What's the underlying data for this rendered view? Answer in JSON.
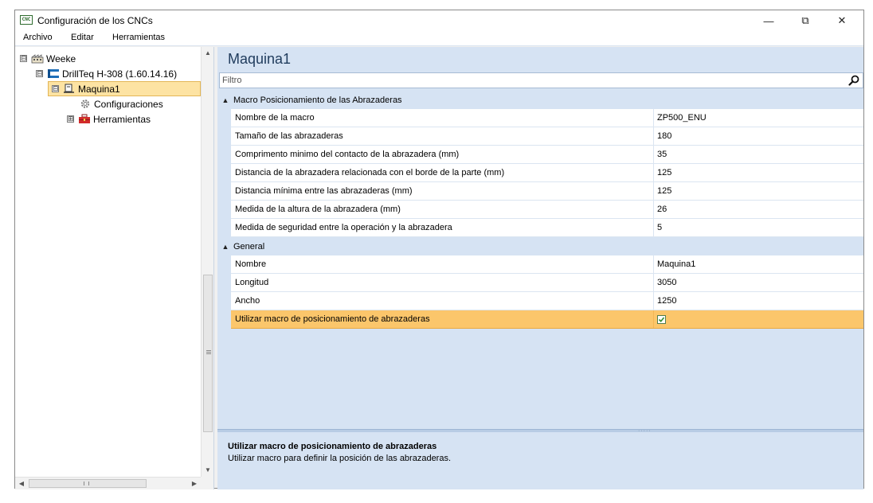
{
  "window": {
    "title": "Configuración de los CNCs",
    "app_icon_text": "CNC",
    "buttons": {
      "minimize": "—",
      "maximize": "⧉",
      "close": "✕"
    }
  },
  "menu": [
    "Archivo",
    "Editar",
    "Herramientas"
  ],
  "tree": {
    "root": {
      "label": "Weeke",
      "expander": "⊟",
      "icon": "factory-icon"
    },
    "machine_type": {
      "label": "DrillTeq H-308 (1.60.14.16)",
      "expander": "⊟",
      "icon": "cnc-machine-icon"
    },
    "machine": {
      "label": "Maquina1",
      "expander": "⊟",
      "icon": "machine-icon",
      "selected": true
    },
    "configurations": {
      "label": "Configuraciones",
      "icon": "gear-icon"
    },
    "tools": {
      "label": "Herramientas",
      "expander": "⊞",
      "icon": "toolbox-icon"
    }
  },
  "panel": {
    "title": "Maquina1",
    "filter_placeholder": "Filtro",
    "categories": [
      {
        "label": "Macro Posicionamiento de las Abrazaderas",
        "toggle": "▲",
        "properties": [
          {
            "name": "Nombre de la macro",
            "value": "ZP500_ENU"
          },
          {
            "name": "Tamaño de las abrazaderas",
            "value": "180"
          },
          {
            "name": "Comprimento minimo del contacto de la abrazadera (mm)",
            "value": "35"
          },
          {
            "name": "Distancia de la abrazadera relacionada con el borde de la parte (mm)",
            "value": "125"
          },
          {
            "name": "Distancia mínima entre las abrazaderas (mm)",
            "value": "125"
          },
          {
            "name": "Medida de la altura de la abrazadera (mm)",
            "value": "26"
          },
          {
            "name": "Medida de seguridad entre la operación y la abrazadera",
            "value": "5"
          }
        ]
      },
      {
        "label": "General",
        "toggle": "▲",
        "properties": [
          {
            "name": "Nombre",
            "value": "Maquina1"
          },
          {
            "name": "Longitud",
            "value": "3050"
          },
          {
            "name": "Ancho",
            "value": "1250"
          },
          {
            "name": "Utilizar macro de posicionamiento de abrazaderas",
            "value": "",
            "checked": true,
            "selected": true
          }
        ]
      }
    ],
    "description": {
      "title": "Utilizar macro de posicionamiento de abrazaderas",
      "text": "Utilizar macro para definir la posición de las abrazaderas."
    }
  },
  "colors": {
    "panel_bg": "#d6e3f3",
    "selection": "#fbc66b",
    "tree_selection": "#fde3a3",
    "checkmark": "#2e8b2e"
  }
}
